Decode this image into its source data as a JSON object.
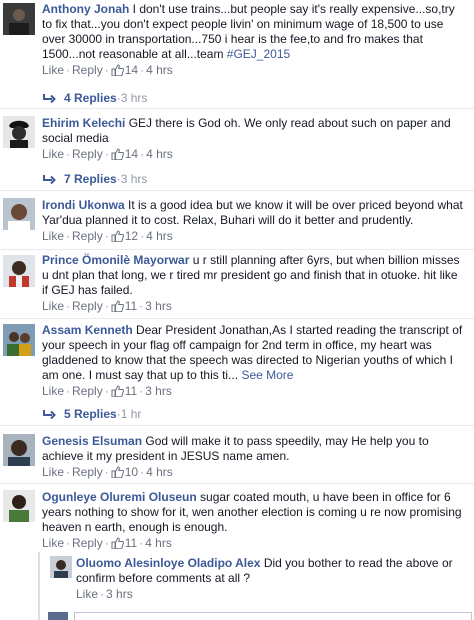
{
  "comments": [
    {
      "author": "Anthony Jonah",
      "text": " I don't use trains...but people say it's really expensive...so,try to fix that...you don't expect people livin' on minimum wage of 18,500 to use over 30000 in transportation...750 i hear is the fee,to and fro makes that 1500...not reasonable at all...team ",
      "hashtag": "#GEJ_2015",
      "like": "Like",
      "reply": "Reply",
      "likes": "14",
      "time": "4 hrs",
      "replies": "4 Replies",
      "replies_time": "3 hrs"
    },
    {
      "author": "Ehirim Kelechi",
      "text": " GEJ there is God oh. We only read about such on paper and social media",
      "like": "Like",
      "reply": "Reply",
      "likes": "14",
      "time": "4 hrs",
      "replies": "7 Replies",
      "replies_time": "3 hrs"
    },
    {
      "author": "Irondi Ukonwa",
      "text": " It is a good idea but we know it will be over priced beyond what Yar'dua planned it to cost. Relax, Buhari will do it better and prudently.",
      "like": "Like",
      "reply": "Reply",
      "likes": "12",
      "time": "4 hrs"
    },
    {
      "author": "Prince Ömonilè Mayorwar",
      "text": " u r still planning after 6yrs, but when billion misses u dnt plan that long, we r tired mr president go and finish that in otuoke. hit like if GEJ has failed.",
      "like": "Like",
      "reply": "Reply",
      "likes": "11",
      "time": "3 hrs"
    },
    {
      "author": "Assam Kenneth",
      "text": " Dear President Jonathan,As I started reading the transcript of your speech in your flag off campaign for 2nd term in office, my heart was gladdened to know that the speech was directed to Nigerian youths of which I am one. I must say that up to this ti... ",
      "see_more": "See More",
      "like": "Like",
      "reply": "Reply",
      "likes": "11",
      "time": "3 hrs",
      "replies": "5 Replies",
      "replies_time": "1 hr"
    },
    {
      "author": "Genesis Elsuman",
      "text": " God will make it to pass speedily, may He help you to achieve it my president in JESUS name amen.",
      "like": "Like",
      "reply": "Reply",
      "likes": "10",
      "time": "4 hrs"
    },
    {
      "author": "Ogunleye Oluremi Oluseun",
      "text": " sugar coated mouth, u have been in office for 6 years nothing to show for it, wen another election is coming u re now promising heaven n earth, enough is enough.",
      "like": "Like",
      "reply": "Reply",
      "likes": "11",
      "time": "4 hrs"
    }
  ],
  "nested_reply": {
    "author": "Oluomo Alesinloye Oladipo Alex",
    "text": " Did you bother to read the above or confirm before comments at all ?",
    "like": "Like",
    "time": "3 hrs"
  },
  "separator": "·",
  "colors": {
    "link": "#3b5998",
    "meta": "#6a7180",
    "divider": "#e9eaed"
  }
}
